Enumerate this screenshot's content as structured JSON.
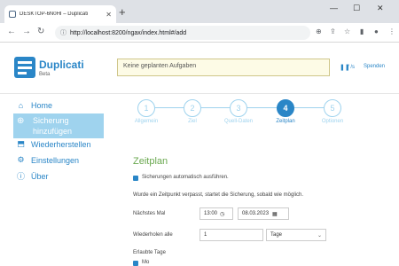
{
  "browser": {
    "tab_title": "DESKTOP-6N0HI – Duplicati",
    "tab_close": "✕",
    "new_tab": "+",
    "url": "http://localhost:8200/ngax/index.html#/add",
    "win_min": "—",
    "win_max": "☐",
    "win_close": "✕"
  },
  "header": {
    "brand": "Duplicati",
    "subtitle": "Beta",
    "status": "Keine geplanten Aufgaben",
    "speed": "/ /s",
    "donate": "Spenden",
    "accent": "#2a86c7"
  },
  "sidebar": {
    "items": [
      {
        "label": "Home",
        "icon": "home-icon"
      },
      {
        "label_line1": "Sicherung",
        "label_line2": "hinzufügen",
        "icon": "plus-icon"
      },
      {
        "label": "Wiederherstellen",
        "icon": "restore-icon"
      },
      {
        "label": "Einstellungen",
        "icon": "gear-icon"
      },
      {
        "label": "Über",
        "icon": "info-icon"
      }
    ]
  },
  "stepper": {
    "steps": [
      {
        "num": "1",
        "label": "Allgemein"
      },
      {
        "num": "2",
        "label": "Ziel"
      },
      {
        "num": "3",
        "label": "Quell-Daten"
      },
      {
        "num": "4",
        "label": "Zeitplan"
      },
      {
        "num": "5",
        "label": "Optionen"
      }
    ],
    "active": 4
  },
  "form": {
    "title": "Zeitplan",
    "auto_run": "Sicherungen automatisch ausführen.",
    "missed_note": "Wurde ein Zeitpunkt verpasst, startet die Sicherung, sobald wie möglich.",
    "next_time_label": "Nächstes Mal",
    "time_value": "13:00",
    "date_value": "08.03.2023",
    "repeat_label": "Wiederholen alle",
    "repeat_value": "1",
    "repeat_unit": "Tage",
    "allowed_days_label": "Erlaubte Tage",
    "first_day": "Mo"
  }
}
